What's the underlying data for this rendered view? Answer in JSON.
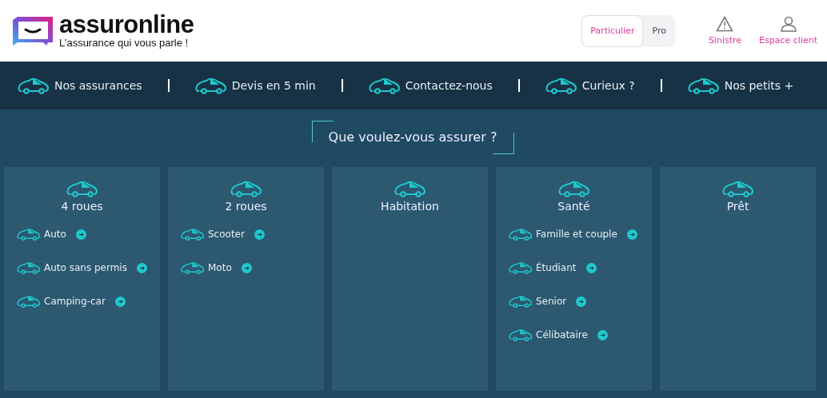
{
  "brand": {
    "name": "assuronline",
    "tagline": "L’assurance qui vous parle !"
  },
  "segments": [
    {
      "label": "Particulier",
      "selected": true
    },
    {
      "label": "Pro",
      "selected": false
    }
  ],
  "header_links": [
    {
      "label": "Sinistre",
      "kind": "warning"
    },
    {
      "label": "Espace client",
      "kind": "user"
    }
  ],
  "nav": [
    "Nos assurances",
    "Devis en 5 min",
    "Contactez-nous",
    "Curieux ?",
    "Nos petits +"
  ],
  "heading": "Que voulez-vous assurer ?",
  "categories": [
    {
      "title": "4 roues",
      "items": [
        "Auto",
        "Auto sans permis",
        "Camping-car"
      ]
    },
    {
      "title": "2 roues",
      "items": [
        "Scooter",
        "Moto"
      ]
    },
    {
      "title": "Habitation"
    },
    {
      "title": "Santé",
      "items": [
        "Famille et couple",
        "Étudiant",
        "Senior",
        "Célibataire"
      ]
    },
    {
      "title": "Prêt"
    }
  ]
}
